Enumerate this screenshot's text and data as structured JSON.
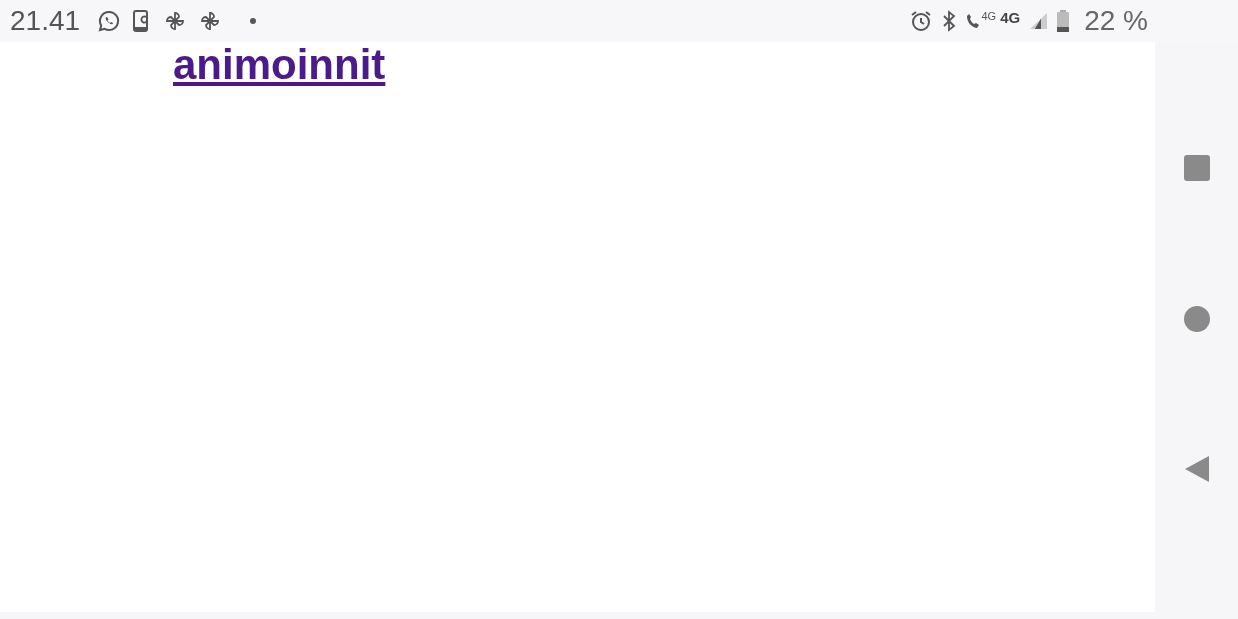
{
  "status_bar": {
    "time": "21.41",
    "call_network": "4G",
    "data_network": "4G",
    "battery": "22 %"
  },
  "page": {
    "link": "animoinnit"
  }
}
